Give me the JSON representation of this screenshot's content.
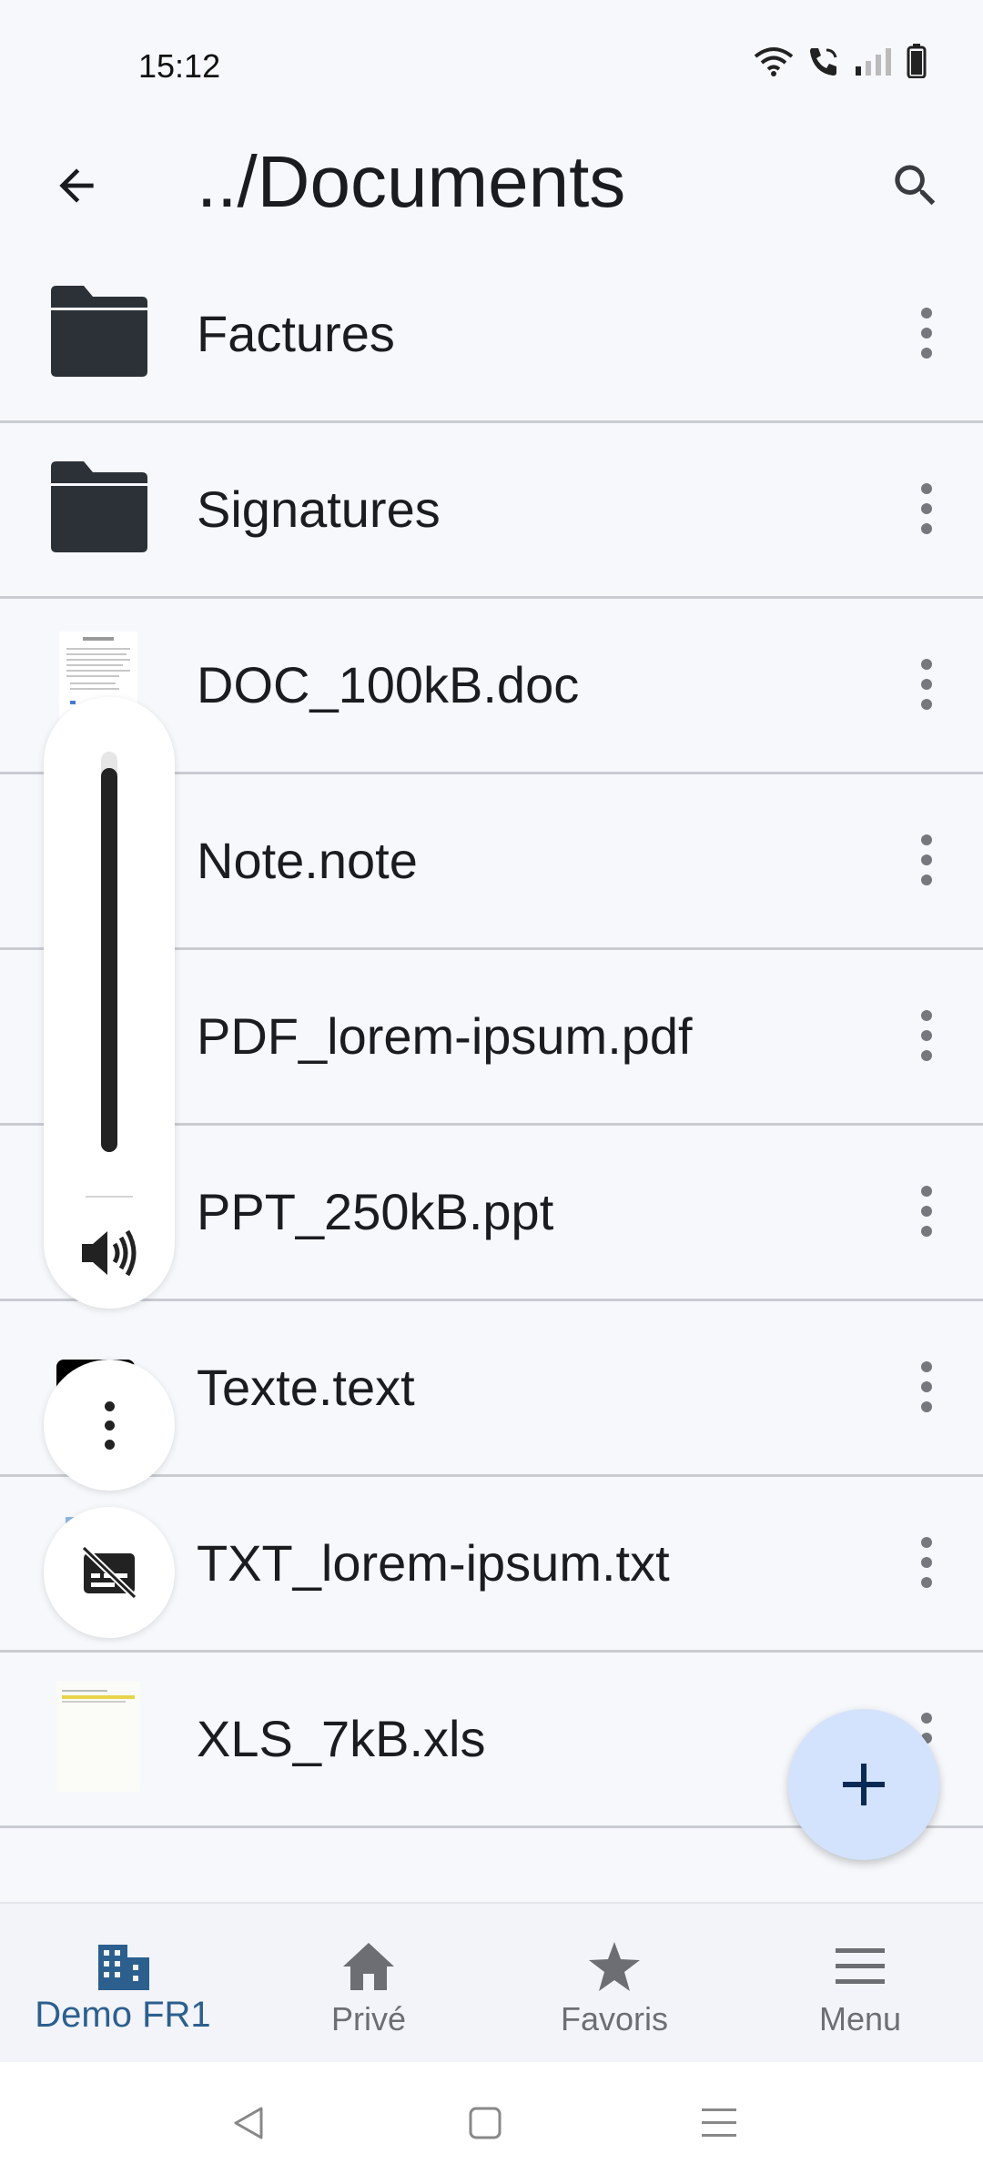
{
  "status_bar": {
    "time": "15:12"
  },
  "header": {
    "title": "../Documents"
  },
  "files": [
    {
      "name": "Factures",
      "kind": "folder"
    },
    {
      "name": "Signatures",
      "kind": "folder"
    },
    {
      "name": "DOC_100kB.doc",
      "kind": "doc"
    },
    {
      "name": "Note.note",
      "kind": "note"
    },
    {
      "name": "PDF_lorem-ipsum.pdf",
      "kind": "pdf"
    },
    {
      "name": "PPT_250kB.ppt",
      "kind": "ppt"
    },
    {
      "name": "Texte.text",
      "kind": "text"
    },
    {
      "name": "TXT_lorem-ipsum.txt",
      "kind": "txt"
    },
    {
      "name": "XLS_7kB.xls",
      "kind": "xls"
    }
  ],
  "volume": {
    "level_percent": 96
  },
  "bottom_nav": [
    {
      "label": "Demo FR1",
      "icon": "building-icon",
      "active": true
    },
    {
      "label": "Privé",
      "icon": "home-icon",
      "active": false
    },
    {
      "label": "Favoris",
      "icon": "star-icon",
      "active": false
    },
    {
      "label": "Menu",
      "icon": "menu-icon",
      "active": false
    }
  ],
  "colors": {
    "accent": "#2c5f8d",
    "fab": "#d3e3fd",
    "folder": "#2b3137"
  }
}
